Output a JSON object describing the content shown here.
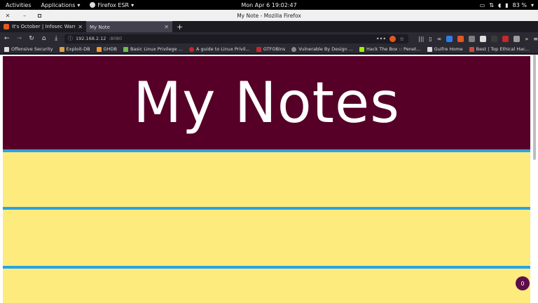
{
  "system": {
    "activities": "Activities",
    "applications": "Applications",
    "firefox_menu": "Firefox ESR",
    "clock": "Mon Apr 6  19:02:47",
    "battery": "83 %"
  },
  "window": {
    "title": "My Note - Mozilla Firefox"
  },
  "tabs": [
    {
      "title": "It's October | Infosec Warrior",
      "active": false
    },
    {
      "title": "My Note",
      "active": true
    }
  ],
  "navbar": {
    "url_host": "192.168.2.12",
    "url_port": ":8080"
  },
  "bookmarks": [
    {
      "label": "Offensive Security",
      "icon": "offsec-icon",
      "color": "#e0e0e0"
    },
    {
      "label": "Exploit-DB",
      "icon": "exploitdb-icon",
      "color": "#d9a441"
    },
    {
      "label": "GHDB",
      "icon": "ghdb-icon",
      "color": "#f09a2a"
    },
    {
      "label": "Basic Linux Privilege ...",
      "icon": "page-icon",
      "color": "#6fbf4b"
    },
    {
      "label": "A guide to Linux Privil...",
      "icon": "guide-icon",
      "color": "#c3282b"
    },
    {
      "label": "GTFOBins",
      "icon": "gtfobins-icon",
      "color": "#c7282b"
    },
    {
      "label": "Vulnerable By Design ...",
      "icon": "vulnhub-icon",
      "color": "#888888"
    },
    {
      "label": "Hack The Box :: Penet...",
      "icon": "htb-icon",
      "color": "#9fef00"
    },
    {
      "label": "Guifre Home",
      "icon": "guifre-icon",
      "color": "#dddddd"
    },
    {
      "label": "Best | Top Ethical Hac...",
      "icon": "ethical-icon",
      "color": "#d04a3c"
    }
  ],
  "page": {
    "heading": "My Notes",
    "badge_count": "0",
    "colors": {
      "header_bg": "#560027",
      "note_bg": "#fdeb7e",
      "rule_line": "#29a3e4",
      "fab_bg": "#5c0d4a"
    }
  }
}
